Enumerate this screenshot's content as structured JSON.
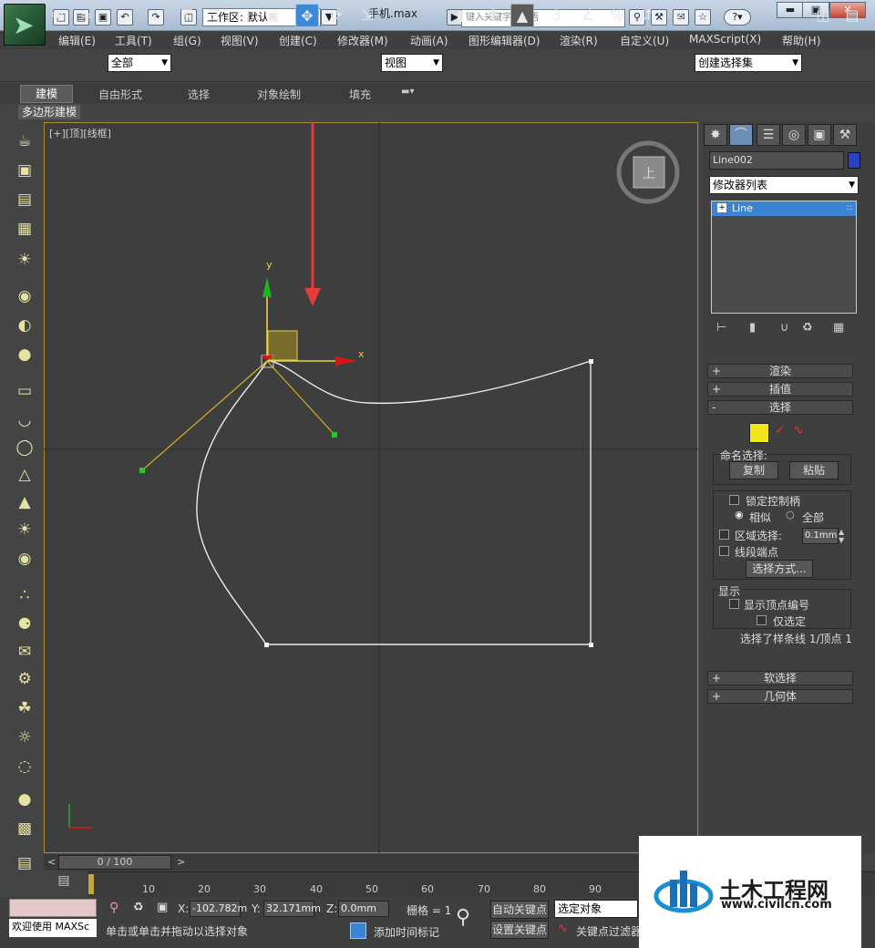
{
  "app": {
    "file_name": "手机.max",
    "workspace": "工作区: 默认",
    "search_placeholder": "键入关键字或短语"
  },
  "menu": [
    "编辑(E)",
    "工具(T)",
    "组(G)",
    "视图(V)",
    "创建(C)",
    "修改器(M)",
    "动画(A)",
    "图形编辑器(D)",
    "渲染(R)",
    "自定义(U)",
    "MAXScript(X)",
    "帮助(H)"
  ],
  "toolbar": {
    "selection_filter": "全部",
    "coord_system": "视图",
    "named_selection": "创建选择集",
    "snap_label": "3",
    "angle_snap_label": "%"
  },
  "ribbon": {
    "tabs": [
      "建模",
      "自由形式",
      "选择",
      "对象绘制",
      "填充"
    ],
    "active_tab": "建模",
    "sub_tab": "多边形建模"
  },
  "viewport": {
    "label": "[+][顶][线框]",
    "viewcube_label": "上",
    "gizmo_x": "x",
    "gizmo_y": "y"
  },
  "command_panel": {
    "object_name": "Line002",
    "object_color": "#2b3fc7",
    "modifier_list": "修改器列表",
    "stack_item": "Line",
    "rollouts": {
      "render": "渲染",
      "interpolation": "插值",
      "selection": "选择",
      "soft_selection": "软选择",
      "geometry": "几何体"
    },
    "named_selection_label": "命名选择:",
    "copy_button": "复制",
    "paste_button": "粘贴",
    "lock_handles": "锁定控制柄",
    "alike": "相似",
    "all": "全部",
    "area_selection": "区域选择:",
    "area_value": "0.1mm",
    "segment_end": "线段端点",
    "select_by": "选择方式...",
    "display_label": "显示",
    "show_vertex_numbers": "显示顶点编号",
    "selected_only": "仅选定",
    "status": "选择了样条线 1/顶点 1"
  },
  "timeline": {
    "frame_display": "0 / 100",
    "ticks": [
      "10",
      "20",
      "30",
      "40",
      "50",
      "60",
      "70",
      "80",
      "90"
    ]
  },
  "statusbar": {
    "welcome": "欢迎使用 MAXSc",
    "x_label": "X:",
    "x_value": "-102.782m",
    "y_label": "Y:",
    "y_value": "32.171mm",
    "z_label": "Z:",
    "z_value": "0.0mm",
    "grid": "栅格 = 1",
    "prompt": "单击或单击并拖动以选择对象",
    "add_time_tag": "添加时间标记",
    "auto_key": "自动关键点",
    "set_key": "设置关键点",
    "selected_object": "选定对象",
    "key_filter": "关键点过滤器"
  },
  "watermark": {
    "brand": "土木工程网",
    "url": "www.civilcn.com"
  },
  "colors": {
    "accent": "#3b84d4",
    "viewport_border": "#a58c2f",
    "handle": "#22cc22"
  }
}
